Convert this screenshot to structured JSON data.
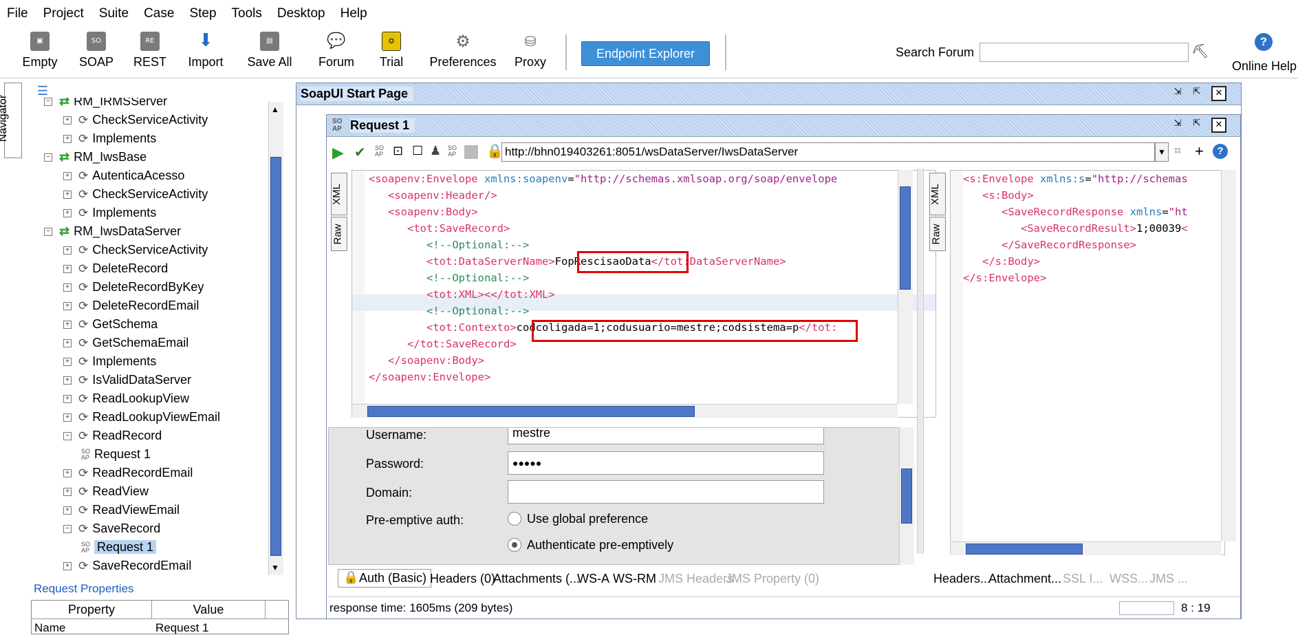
{
  "menu": [
    "File",
    "Project",
    "Suite",
    "Case",
    "Step",
    "Tools",
    "Desktop",
    "Help"
  ],
  "toolbar": {
    "empty": "Empty",
    "soap": "SOAP",
    "rest": "REST",
    "import": "Import",
    "save_all": "Save All",
    "forum": "Forum",
    "trial": "Trial",
    "preferences": "Preferences",
    "proxy": "Proxy",
    "endpoint_explorer": "Endpoint Explorer",
    "search_forum": "Search Forum",
    "online_help": "Online Help"
  },
  "navigator_label": "Navigator",
  "tree": [
    {
      "label": "RM_IRMSServer",
      "level": 0,
      "kind": "iface"
    },
    {
      "label": "CheckServiceActivity",
      "level": 1,
      "kind": "op"
    },
    {
      "label": "Implements",
      "level": 1,
      "kind": "op"
    },
    {
      "label": "RM_IwsBase",
      "level": 0,
      "kind": "iface"
    },
    {
      "label": "AutenticaAcesso",
      "level": 1,
      "kind": "op"
    },
    {
      "label": "CheckServiceActivity",
      "level": 1,
      "kind": "op"
    },
    {
      "label": "Implements",
      "level": 1,
      "kind": "op"
    },
    {
      "label": "RM_IwsDataServer",
      "level": 0,
      "kind": "iface"
    },
    {
      "label": "CheckServiceActivity",
      "level": 1,
      "kind": "op"
    },
    {
      "label": "DeleteRecord",
      "level": 1,
      "kind": "op"
    },
    {
      "label": "DeleteRecordByKey",
      "level": 1,
      "kind": "op"
    },
    {
      "label": "DeleteRecordEmail",
      "level": 1,
      "kind": "op"
    },
    {
      "label": "GetSchema",
      "level": 1,
      "kind": "op"
    },
    {
      "label": "GetSchemaEmail",
      "level": 1,
      "kind": "op"
    },
    {
      "label": "Implements",
      "level": 1,
      "kind": "op"
    },
    {
      "label": "IsValidDataServer",
      "level": 1,
      "kind": "op"
    },
    {
      "label": "ReadLookupView",
      "level": 1,
      "kind": "op"
    },
    {
      "label": "ReadLookupViewEmail",
      "level": 1,
      "kind": "op"
    },
    {
      "label": "ReadRecord",
      "level": 1,
      "kind": "op"
    },
    {
      "label": "Request 1",
      "level": 2,
      "kind": "req"
    },
    {
      "label": "ReadRecordEmail",
      "level": 1,
      "kind": "op"
    },
    {
      "label": "ReadView",
      "level": 1,
      "kind": "op"
    },
    {
      "label": "ReadViewEmail",
      "level": 1,
      "kind": "op"
    },
    {
      "label": "SaveRecord",
      "level": 1,
      "kind": "op"
    },
    {
      "label": "Request 1",
      "level": 2,
      "kind": "req",
      "selected": true
    },
    {
      "label": "SaveRecordEmail",
      "level": 1,
      "kind": "op"
    }
  ],
  "request_properties": {
    "title": "Request Properties",
    "col_property": "Property",
    "col_value": "Value",
    "row_name": "Name",
    "row_value": "Request 1"
  },
  "start_page_title": "SoapUI Start Page",
  "request": {
    "title": "Request 1",
    "endpoint": "http://bhn019403261:8051/wsDataServer/IwsDataServer",
    "tab_xml": "XML",
    "tab_raw": "Raw",
    "xml_lines": [
      "<soapenv:Envelope xmlns:soapenv=\"http://schemas.xmlsoap.org/soap/envelope",
      "   <soapenv:Header/>",
      "   <soapenv:Body>",
      "      <tot:SaveRecord>",
      "         <!--Optional:-->",
      "         <tot:DataServerName>FopRescisaoData</tot:DataServerName>",
      "         <!--Optional:-->",
      "         <tot:XML><</tot:XML>",
      "         <!--Optional:-->",
      "         <tot:Contexto>codcoligada=1;codusuario=mestre;codsistema=p</tot:",
      "      </tot:SaveRecord>",
      "   </soapenv:Body>",
      "</soapenv:Envelope>"
    ],
    "response_lines": [
      "<s:Envelope xmlns:s=\"http://schemas",
      "   <s:Body>",
      "      <SaveRecordResponse xmlns=\"ht",
      "         <SaveRecordResult>1;00039<",
      "      </SaveRecordResponse>",
      "   </s:Body>",
      "</s:Envelope>"
    ],
    "auth": {
      "username_label": "Username:",
      "username": "mestre",
      "password_label": "Password:",
      "password": "●●●●●",
      "domain_label": "Domain:",
      "domain": "",
      "preemptive_label": "Pre-emptive auth:",
      "opt_global": "Use global preference",
      "opt_preemptive": "Authenticate pre-emptively"
    },
    "bottom_tabs": [
      "Auth (Basic)",
      "Headers (0)",
      "Attachments (...",
      "WS-A",
      "WS-RM",
      "JMS Headers",
      "JMS Property (0)"
    ],
    "response_tabs": [
      "Headers...",
      "Attachment...",
      "SSL I...",
      "WSS...",
      "JMS ..."
    ],
    "status": "response time: 1605ms (209 bytes)",
    "cursor": "8 : 19"
  }
}
